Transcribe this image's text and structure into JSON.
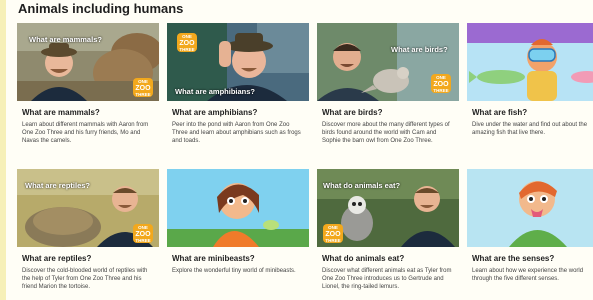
{
  "section": {
    "title": "Animals including humans"
  },
  "cards": [
    {
      "title": "What are mammals?",
      "overlay": "What are mammals?",
      "description": "Learn about different mammals with Aaron from One Zoo Three and his furry friends, Mo and Navas the camels.",
      "logo": [
        "ONE",
        "ZOO",
        "THREE"
      ]
    },
    {
      "title": "What are amphibians?",
      "overlay": "What are amphibians?",
      "description": "Peer into the pond with Aaron from One Zoo Three and learn about amphibians such as frogs and toads.",
      "logo": [
        "ONE",
        "ZOO",
        "THREE"
      ]
    },
    {
      "title": "What are birds?",
      "overlay": "What are birds?",
      "description": "Discover more about the many different types of birds found around the world with Cam and Sophie the barn owl from One Zoo Three.",
      "logo": [
        "ONE",
        "ZOO",
        "THREE"
      ]
    },
    {
      "title": "What are fish?",
      "description": "Dive under the water and find out about the amazing fish that live there."
    },
    {
      "title": "What are reptiles?",
      "overlay": "What are reptiles?",
      "description": "Discover the cold-blooded world of reptiles with the help of Tyler from One Zoo Three and his friend Marion the tortoise.",
      "logo": [
        "ONE",
        "ZOO",
        "THREE"
      ]
    },
    {
      "title": "What are minibeasts?",
      "description": "Explore the wonderful tiny world of minibeasts."
    },
    {
      "title": "What do animals eat?",
      "overlay": "What do animals eat?",
      "description": "Discover what different animals eat as Tyler from One Zoo Three introduces us to Gertrude and Lionel, the ring-tailed lemurs.",
      "logo": [
        "ONE",
        "ZOO",
        "THREE"
      ]
    },
    {
      "title": "What are the senses?",
      "description": "Learn about how we experience the world through the five different senses."
    }
  ]
}
